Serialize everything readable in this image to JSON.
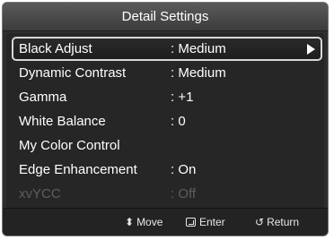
{
  "title": "Detail Settings",
  "menu": [
    {
      "label": "Black Adjust",
      "value": ": Medium",
      "selected": true,
      "disabled": false
    },
    {
      "label": "Dynamic Contrast",
      "value": ": Medium",
      "selected": false,
      "disabled": false
    },
    {
      "label": "Gamma",
      "value": ": +1",
      "selected": false,
      "disabled": false
    },
    {
      "label": "White Balance",
      "value": ": 0",
      "selected": false,
      "disabled": false
    },
    {
      "label": "My Color Control",
      "value": "",
      "selected": false,
      "disabled": false
    },
    {
      "label": "Edge Enhancement",
      "value": ": On",
      "selected": false,
      "disabled": false
    },
    {
      "label": "xvYCC",
      "value": ": Off",
      "selected": false,
      "disabled": true
    }
  ],
  "footer": {
    "move_icon": "up-down-arrows-icon",
    "move_label": "Move",
    "enter_icon": "enter-icon",
    "enter_label": "Enter",
    "return_icon": "return-icon",
    "return_label": "Return"
  },
  "colors": {
    "background": "#2e2e2e",
    "text": "#ffffff",
    "disabled_text": "#5e5e5e",
    "selection_border": "#d8d8d8"
  }
}
